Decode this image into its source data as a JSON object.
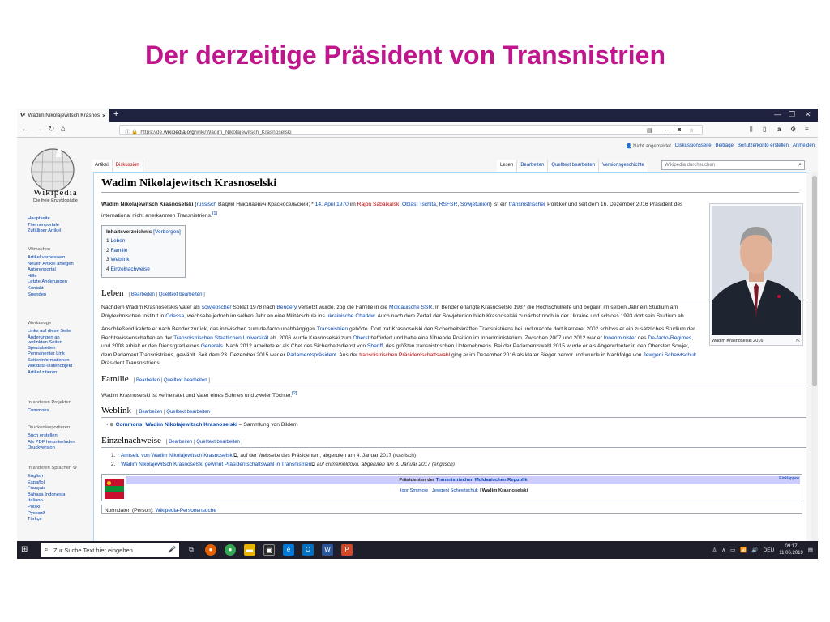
{
  "slide": {
    "title": "Der derzeitige Präsident von Transnistrien"
  },
  "browser": {
    "tab_title": "Wadim Nikolajewitsch Krasnoselski",
    "url_prefix": "https://de.",
    "url_domain": "wikipedia.org",
    "url_path": "/wiki/Wadim_Nikolajewitsch_Krasnoselski",
    "menu_dots": "···"
  },
  "logo": {
    "name": "Wikipedia",
    "subtitle": "Die freie Enzyklopädie"
  },
  "sidebar": {
    "main_links": [
      "Hauptseite",
      "Themenportale",
      "Zufälliger Artikel"
    ],
    "mitmachen_heading": "Mitmachen",
    "mitmachen_links": [
      "Artikel verbessern",
      "Neuen Artikel anlegen",
      "Autorenportal",
      "Hilfe",
      "Letzte Änderungen",
      "Kontakt",
      "Spenden"
    ],
    "werkzeuge_heading": "Werkzeuge",
    "werkzeuge_links": [
      "Links auf diese Seite",
      "Änderungen an verlinkten Seiten",
      "Spezialseiten",
      "Permanenter Link",
      "Seiteninformationen",
      "Wikidata-Datenobjekt",
      "Artikel zitieren"
    ],
    "projekte_heading": "In anderen Projekten",
    "projekte_links": [
      "Commons"
    ],
    "drucken_heading": "Drucken/exportieren",
    "drucken_links": [
      "Buch erstellen",
      "Als PDF herunterladen",
      "Druckversion"
    ],
    "sprachen_heading": "In anderen Sprachen",
    "sprachen_links": [
      "English",
      "Español",
      "Français",
      "Bahasa Indonesia",
      "Italiano",
      "Polski",
      "Русский",
      "Türkçe"
    ]
  },
  "topright": {
    "not_logged_in": "Nicht angemeldet",
    "links": [
      "Diskussionsseite",
      "Beiträge",
      "Benutzerkonto erstellen",
      "Anmelden"
    ]
  },
  "ns_tabs": {
    "article": "Artikel",
    "discussion": "Diskussion"
  },
  "view_tabs": {
    "read": "Lesen",
    "edit": "Bearbeiten",
    "edit_source": "Quelltext bearbeiten",
    "history": "Versionsgeschichte"
  },
  "search": {
    "placeholder": "Wikipedia durchsuchen"
  },
  "article": {
    "title": "Wadim Nikolajewitsch Krasnoselski",
    "lead": {
      "name": "Wadim Nikolajewitsch Krasnoselski",
      "t1": " (",
      "russisch": "russisch",
      "t2": " Вадим Николаевич Красносельский; * ",
      "birth": "14. April 1970",
      "t3": " im ",
      "rajon": "Rajon Sabaikalsk",
      "t4": ", ",
      "oblast": "Oblast Tschita",
      "t5": ", ",
      "rsfsr": "RSFSR",
      "t6": ", ",
      "su": "Sowjetunion",
      "t7": ") ist ein ",
      "transnistrisch": "transnistrischer",
      "t8": " Politiker und seit dem 16. Dezember 2016 Präsident des international nicht anerkannten Transnistriens.",
      "ref": "[1]"
    },
    "toc": {
      "title": "Inhaltsverzeichnis",
      "toggle": "[Verbergen]",
      "items": [
        {
          "num": "1",
          "label": "Leben"
        },
        {
          "num": "2",
          "label": "Familie"
        },
        {
          "num": "3",
          "label": "Weblink"
        },
        {
          "num": "4",
          "label": "Einzelnachweise"
        }
      ]
    },
    "edit_links": {
      "edit": "Bearbeiten",
      "sep": " | ",
      "edit_source": "Quelltext bearbeiten",
      "open": "[ ",
      "close": " ]"
    },
    "sections": {
      "leben": "Leben",
      "familie": "Familie",
      "weblink": "Weblink",
      "einzelnachweise": "Einzelnachweise"
    },
    "leben_p1": {
      "t1": "Nachdem Wadim Krasnoselskis Vater als ",
      "a1": "sowjetischer",
      "t2": " Soldat 1978 nach ",
      "a2": "Bendery",
      "t3": " versetzt wurde, zog die Familie in die ",
      "a3": "Moldauische SSR",
      "t4": ". In Bender erlangte Krasnoselski 1987 die Hochschulreife und begann im selben Jahr ein Studium am Polytechnischen Institut in ",
      "a4": "Odessa",
      "t5": ", wechselte jedoch im selben Jahr an eine Militärschule ins ",
      "a5": "ukrainische",
      "t6": " ",
      "a6": "Charkiw",
      "t7": ". Auch nach dem Zerfall der Sowjetunion blieb Krasnoselski zunächst noch in der Ukraine und schloss 1993 dort sein Studium ab."
    },
    "leben_p2": {
      "t1": "Anschließend kehrte er nach Bender zurück, das inzwischen zum de-facto unabhängigen ",
      "a1": "Transnistrien",
      "t2": " gehörte. Dort trat Krasnoselski den Sicherheitskräften Transnistriens bei und machte dort Karriere. 2002 schloss er ein zusätzliches Studium der Rechtswissenschaften an der ",
      "a2": "Transnistrischen Staatlichen Universität",
      "t3": " ab. 2006 wurde Krasnoselski zum ",
      "a3": "Oberst",
      "t4": " befördert und hatte eine führende Position im Innenministerium. Zwischen 2007 und 2012 war er ",
      "a4": "Innenminister",
      "t5": " des ",
      "a5": "De-facto-Regimes",
      "t6": ", und 2008 erhielt er den Dienstgrad eines ",
      "a6": "Generals",
      "t7": ". Nach 2012 arbeitete er als Chef des Sicherheitsdienst von ",
      "a7": "Sheriff",
      "t8": ", des größten transnistrischen Unternehmens. Bei der Parlamentswahl 2015 wurde er als Abgeordneter in den Obersten Sowjet, dem Parlament Transnistriens, gewählt. Seit dem 23. Dezember 2015 war er ",
      "a8": "Parlamentspräsident",
      "t9": ". Aus der ",
      "a9": "transnistrischen Präsidentschaftswahl",
      "t10": " ging er im Dezember 2016 als klarer Sieger hervor und wurde in Nachfolge von ",
      "a10": "Jewgeni Schewtschuk",
      "t11": " Präsident Transnistriens."
    },
    "familie_p": {
      "text": "Wadim Krasnoselski ist verheiratet und Vater eines Sohnes und zweier Töchter.",
      "ref": "[2]"
    },
    "weblink_item": {
      "link": "Commons: Wadim Nikolajewitsch Krasnoselski",
      "rest": " – Sammlung von Bildern"
    },
    "refs": [
      {
        "marker": "1. ↑ ",
        "link": "Amtseid von Wadim Nikolajewitsch Krasnoselski",
        "rest": ", auf der Webseite des Präsidenten, abgerufen am 4. Januar 2017 (russisch)"
      },
      {
        "marker": "2. ↑ ",
        "link": "Wadim Nikolajewitsch Krasnoselski gewinnt Präsidentschaftswahl in Transnistrien",
        "rest": " auf crimemoldova, abgerufen am 3. Januar 2017 (englisch)"
      }
    ],
    "navbox": {
      "prefix": "Präsidenten der ",
      "link": "Transnistrischen Moldauischen Republik",
      "toggle": "Einklappen",
      "p1": "Igor Smirnow",
      "sep1": " | ",
      "p2": "Jewgeni Schewtschuk",
      "sep2": " | ",
      "p3": "Wadim Krasnoselski"
    },
    "normdaten": {
      "label": "Normdaten (Person): ",
      "link": "Wikipedia-Personensuche"
    },
    "infobox_caption": "Wadim Krasnoselski 2016"
  },
  "taskbar": {
    "search_placeholder": "Zur Suche Text hier eingeben",
    "lang": "DEU",
    "time": "09:17",
    "date": "11.06.2019"
  }
}
